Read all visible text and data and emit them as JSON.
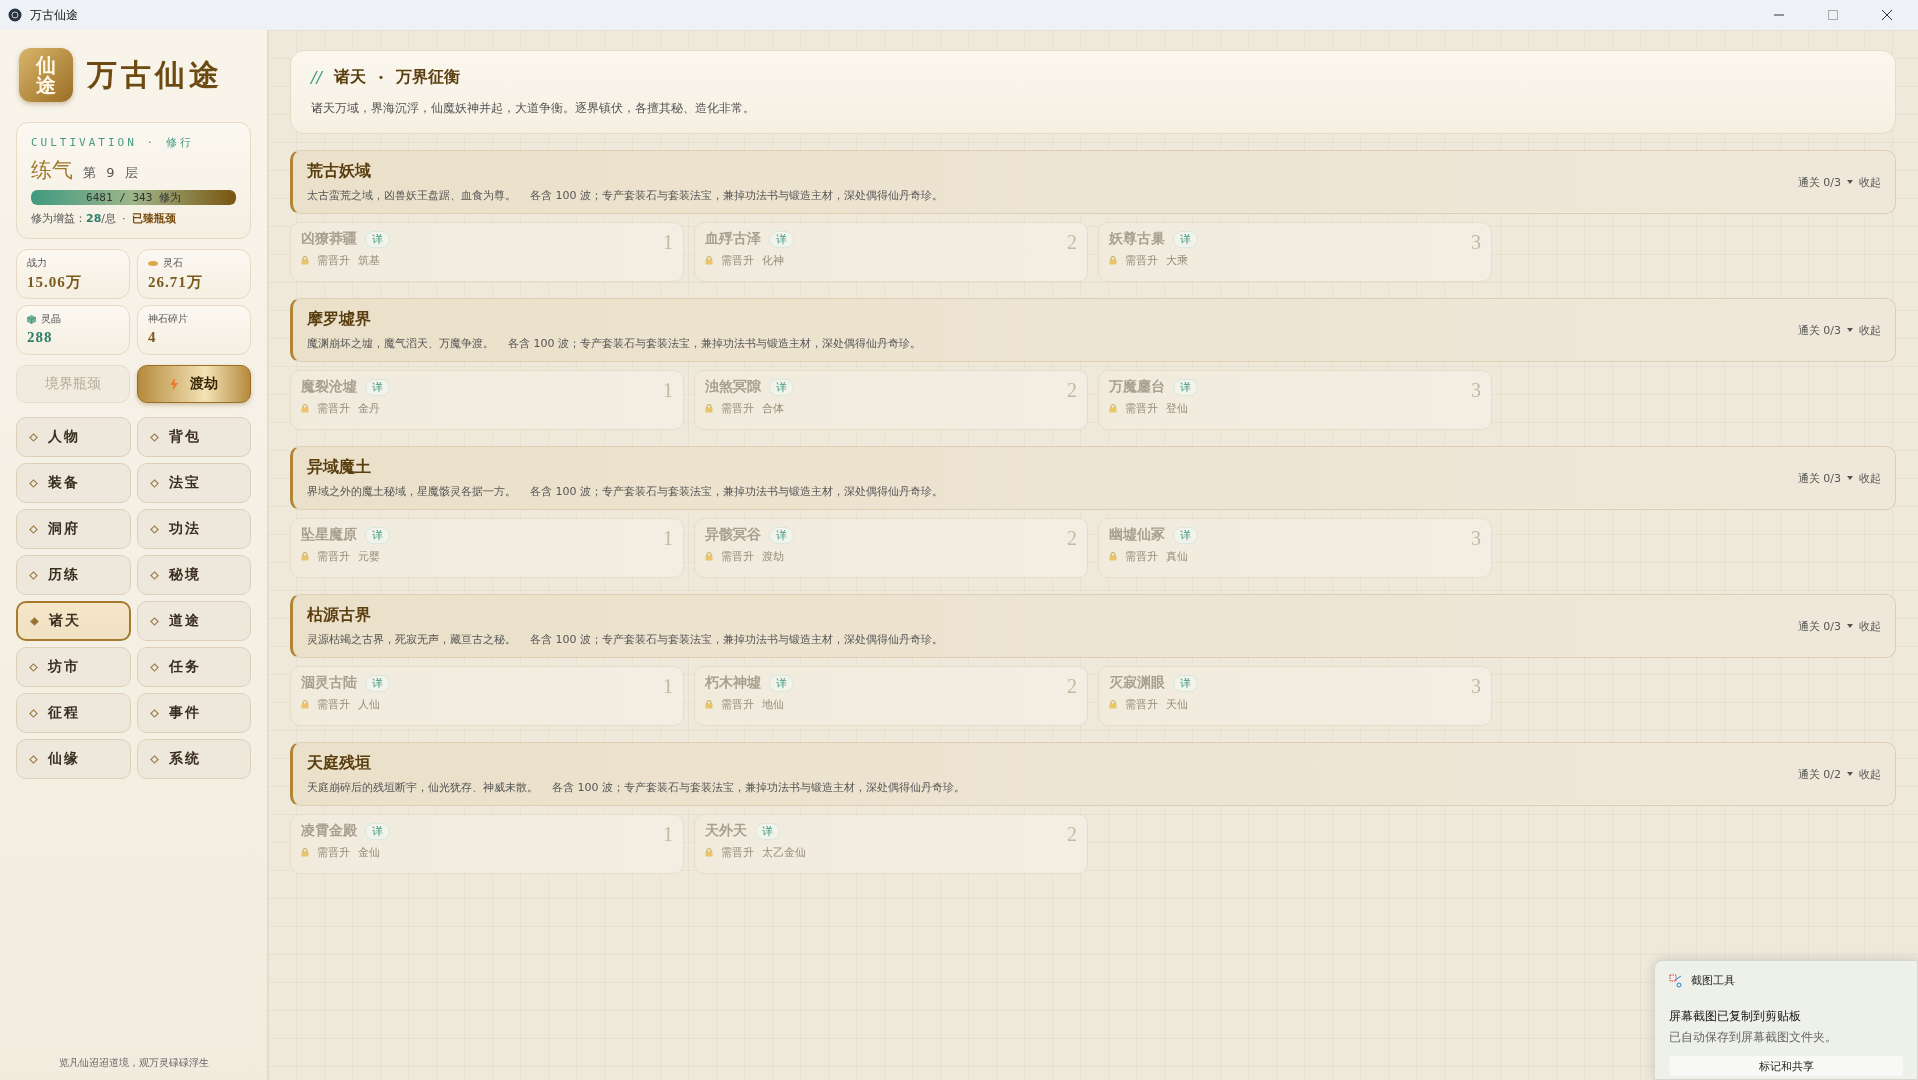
{
  "window": {
    "title": "万古仙途"
  },
  "sidebar": {
    "logo": {
      "badge": "仙途",
      "title": "万古仙途"
    },
    "cultivation": {
      "label": "CULTIVATION · 修行",
      "realm": "练气",
      "stage": "第 9 层",
      "progress": {
        "level": 1,
        "text": "6481 / 343 修为"
      },
      "gain": "修为增益：**28**/息",
      "separator": "·",
      "status": "已臻瓶颈"
    },
    "stats": [
      {
        "label": "战力",
        "value": "15.06万",
        "color": "#7a5a1c"
      },
      {
        "label": "灵石",
        "value": "26.71万",
        "color": "#7a5a1c"
      },
      {
        "label": "灵晶",
        "value": "288",
        "color": "#2e7d6b"
      },
      {
        "label": "神石碎片",
        "value": "4",
        "color": "#7a5a1c"
      }
    ],
    "actions": [
      {
        "label": "境界瓶颈",
        "kind": "plain",
        "disabled": true
      },
      {
        "label": "渡劫",
        "kind": "primary",
        "disabled": false
      }
    ],
    "nav": [
      {
        "label": "人物",
        "selected": false
      },
      {
        "label": "背包",
        "selected": false
      },
      {
        "label": "装备",
        "selected": false
      },
      {
        "label": "法宝",
        "selected": false
      },
      {
        "label": "洞府",
        "selected": false
      },
      {
        "label": "功法",
        "selected": false
      },
      {
        "label": "历练",
        "selected": false
      },
      {
        "label": "秘境",
        "selected": false
      },
      {
        "label": "诸天",
        "selected": true
      },
      {
        "label": "道途",
        "selected": false
      },
      {
        "label": "坊市",
        "selected": false
      },
      {
        "label": "任务",
        "selected": false
      },
      {
        "label": "征程",
        "selected": false
      },
      {
        "label": "事件",
        "selected": false
      },
      {
        "label": "仙缘",
        "selected": false
      },
      {
        "label": "系统",
        "selected": false
      }
    ],
    "footer": "览凡仙迢迢道境，观万灵碌碌浮生"
  },
  "header": {
    "prefix": "//",
    "title": "诸天",
    "separator": "•",
    "subtitle": "万界征衡",
    "description": "诸天万域，界海沉浮，仙魔妖神并起，大道争衡。逐界镇伏，各擅其秘、造化非常。"
  },
  "realms": [
    {
      "name": "荒古妖域",
      "description": "太古蛮荒之域，凶兽妖王盘踞、血食为尊。",
      "waves": "各含 100 波；专产套装石与套装法宝，兼掉功法书与锻造主材，深处偶得仙丹奇珍。",
      "progress": "通关 0/3",
      "toggle": "收起",
      "stages": [
        {
          "name": "凶獠莽疆",
          "detail": "详",
          "requirement_label": "需晋升",
          "requirement": "筑基",
          "index": "1",
          "locked": true
        },
        {
          "name": "血殍古泽",
          "detail": "详",
          "requirement_label": "需晋升",
          "requirement": "化神",
          "index": "2",
          "locked": true
        },
        {
          "name": "妖尊古巢",
          "detail": "详",
          "requirement_label": "需晋升",
          "requirement": "大乘",
          "index": "3",
          "locked": true
        }
      ]
    },
    {
      "name": "摩罗墟界",
      "description": "魔渊崩坏之墟，魔气滔天、万魔争渡。",
      "waves": "各含 100 波；专产套装石与套装法宝，兼掉功法书与锻造主材，深处偶得仙丹奇珍。",
      "progress": "通关 0/3",
      "toggle": "收起",
      "stages": [
        {
          "name": "魔裂沧墟",
          "detail": "详",
          "requirement_label": "需晋升",
          "requirement": "金丹",
          "index": "1",
          "locked": true
        },
        {
          "name": "浊煞冥隙",
          "detail": "详",
          "requirement_label": "需晋升",
          "requirement": "合体",
          "index": "2",
          "locked": true
        },
        {
          "name": "万魔鏖台",
          "detail": "详",
          "requirement_label": "需晋升",
          "requirement": "登仙",
          "index": "3",
          "locked": true
        }
      ]
    },
    {
      "name": "异域魔土",
      "description": "界域之外的魔土秘域，星魔骸灵各据一方。",
      "waves": "各含 100 波；专产套装石与套装法宝，兼掉功法书与锻造主材，深处偶得仙丹奇珍。",
      "progress": "通关 0/3",
      "toggle": "收起",
      "stages": [
        {
          "name": "坠星魔原",
          "detail": "详",
          "requirement_label": "需晋升",
          "requirement": "元婴",
          "index": "1",
          "locked": true
        },
        {
          "name": "异骸冥谷",
          "detail": "详",
          "requirement_label": "需晋升",
          "requirement": "渡劫",
          "index": "2",
          "locked": true
        },
        {
          "name": "幽墟仙冢",
          "detail": "详",
          "requirement_label": "需晋升",
          "requirement": "真仙",
          "index": "3",
          "locked": true
        }
      ]
    },
    {
      "name": "枯源古界",
      "description": "灵源枯竭之古界，死寂无声，藏亘古之秘。",
      "waves": "各含 100 波；专产套装石与套装法宝，兼掉功法书与锻造主材，深处偶得仙丹奇珍。",
      "progress": "通关 0/3",
      "toggle": "收起",
      "stages": [
        {
          "name": "涸灵古陆",
          "detail": "详",
          "requirement_label": "需晋升",
          "requirement": "人仙",
          "index": "1",
          "locked": true
        },
        {
          "name": "朽木神墟",
          "detail": "详",
          "requirement_label": "需晋升",
          "requirement": "地仙",
          "index": "2",
          "locked": true
        },
        {
          "name": "灭寂渊眼",
          "detail": "详",
          "requirement_label": "需晋升",
          "requirement": "天仙",
          "index": "3",
          "locked": true
        }
      ]
    },
    {
      "name": "天庭残垣",
      "description": "天庭崩碎后的残垣断宇，仙光犹存、神威未散。",
      "waves": "各含 100 波；专产套装石与套装法宝，兼掉功法书与锻造主材，深处偶得仙丹奇珍。",
      "progress": "通关 0/2",
      "toggle": "收起",
      "stages": [
        {
          "name": "凌霄金殿",
          "detail": "详",
          "requirement_label": "需晋升",
          "requirement": "金仙",
          "index": "1",
          "locked": true
        },
        {
          "name": "天外天",
          "detail": "详",
          "requirement_label": "需晋升",
          "requirement": "太乙金仙",
          "index": "2",
          "locked": true
        }
      ]
    }
  ],
  "toast": {
    "app": "截图工具",
    "title": "屏幕截图已复制到剪贴板",
    "body": "已自动保存到屏幕截图文件夹。",
    "action": "标记和共享"
  }
}
